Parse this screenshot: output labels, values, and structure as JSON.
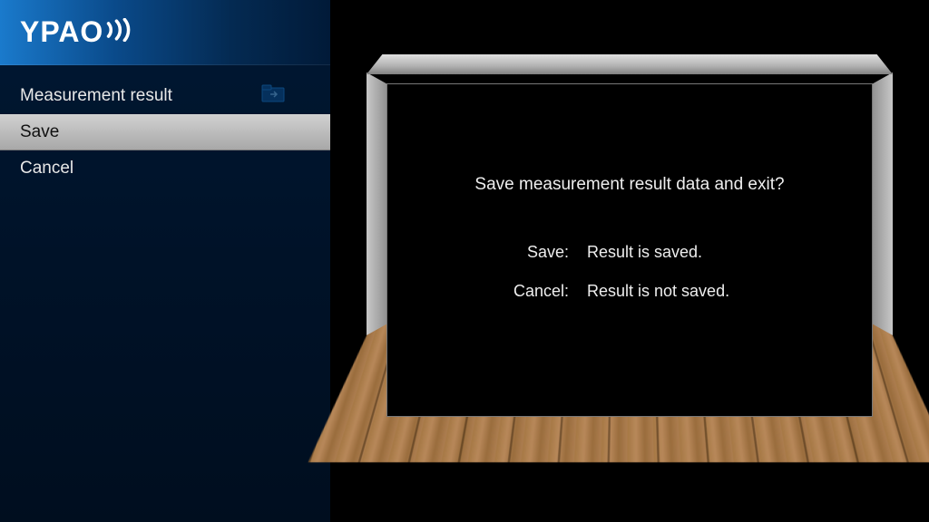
{
  "header": {
    "logo_text": "YPAO"
  },
  "menu": {
    "items": [
      {
        "label": "Measurement result",
        "selected": false,
        "has_folder_icon": true
      },
      {
        "label": "Save",
        "selected": true,
        "has_folder_icon": false
      },
      {
        "label": "Cancel",
        "selected": false,
        "has_folder_icon": false
      }
    ]
  },
  "dialog": {
    "prompt": "Save measurement result data and exit?",
    "options": [
      {
        "label": "Save:",
        "desc": "Result is saved."
      },
      {
        "label": "Cancel:",
        "desc": "Result is not saved."
      }
    ]
  }
}
